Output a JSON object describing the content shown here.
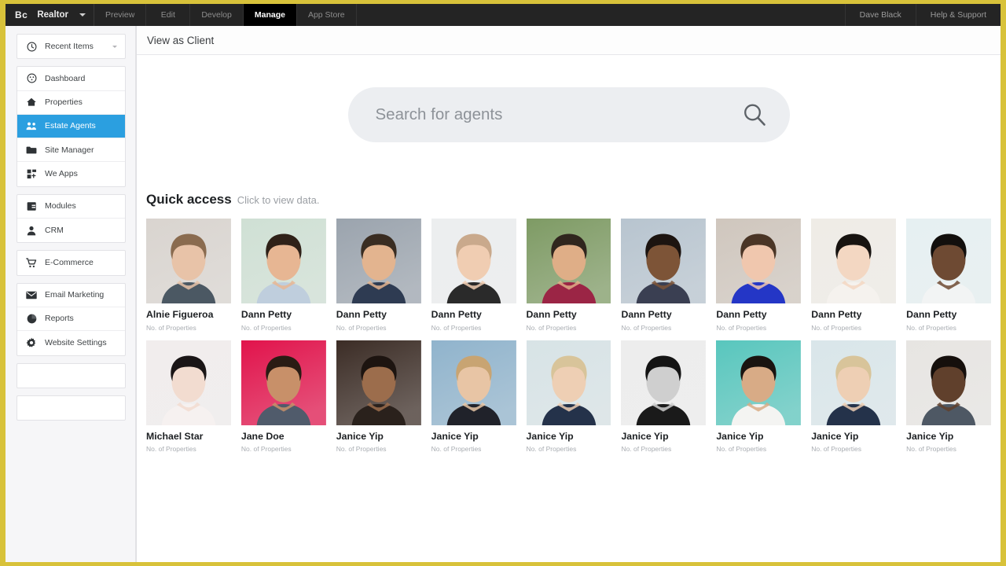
{
  "topbar": {
    "logo_mark": "Bc",
    "site_name": "Realtor",
    "dropdown_icon": "chevron-down-icon",
    "tabs": [
      {
        "label": "Preview",
        "active": false
      },
      {
        "label": "Edit",
        "active": false
      },
      {
        "label": "Develop",
        "active": false
      },
      {
        "label": "Manage",
        "active": true
      },
      {
        "label": "App Store",
        "active": false
      }
    ],
    "right_items": [
      {
        "label": "Dave Black"
      },
      {
        "label": "Help & Support"
      }
    ],
    "bar_color": "#242424",
    "active_tab_color": "#000000"
  },
  "sidebar": {
    "recent": {
      "label": "Recent Items",
      "icon": "clock-icon"
    },
    "items": [
      {
        "label": "Dashboard",
        "icon": "dashboard-icon",
        "active": false
      },
      {
        "label": "Properties",
        "icon": "home-icon",
        "active": false
      },
      {
        "label": "Estate Agents",
        "icon": "people-icon",
        "active": true
      },
      {
        "label": "Site Manager",
        "icon": "folder-icon",
        "active": false
      },
      {
        "label": "We Apps",
        "icon": "apps-icon",
        "active": false
      }
    ],
    "items2": [
      {
        "label": "Modules",
        "icon": "modules-icon",
        "active": false
      },
      {
        "label": "CRM",
        "icon": "person-icon",
        "active": false
      }
    ],
    "items3": [
      {
        "label": "E-Commerce",
        "icon": "cart-icon",
        "active": false
      }
    ],
    "items4": [
      {
        "label": "Email Marketing",
        "icon": "envelope-icon",
        "active": false
      },
      {
        "label": "Reports",
        "icon": "pie-chart-icon",
        "active": false
      },
      {
        "label": "Website Settings",
        "icon": "gear-icon",
        "active": false
      }
    ],
    "empty_rows": 2,
    "active_color": "#2b9fe0"
  },
  "main": {
    "header_title": "View as Client",
    "search": {
      "placeholder": "Search for agents",
      "value": "",
      "icon": "search-icon"
    },
    "quick_access": {
      "title": "Quick access",
      "subtitle": "Click to view data."
    },
    "footer_note": "",
    "cards": [
      {
        "name": "Alnie Figueroa",
        "sub": "No. of Properties",
        "bg": "#d9d4cf",
        "skin": "#e8c3a8",
        "hair": "#8a6b4f",
        "shirt": "#4b5863"
      },
      {
        "name": "Dann Petty",
        "sub": "No. of Properties",
        "bg": "#cfe0d4",
        "skin": "#e7b693",
        "hair": "#2f2118",
        "shirt": "#bfcedd"
      },
      {
        "name": "Dann Petty",
        "sub": "No. of Properties",
        "bg": "#9aa3ad",
        "skin": "#e3b48f",
        "hair": "#3a2d22",
        "shirt": "#2e3b52"
      },
      {
        "name": "Dann Petty",
        "sub": "No. of Properties",
        "bg": "#eceeef",
        "skin": "#f0cdb2",
        "hair": "#c9a98c",
        "shirt": "#2a2a2a"
      },
      {
        "name": "Dann Petty",
        "sub": "No. of Properties",
        "bg": "#7d9a63",
        "skin": "#dfae87",
        "hair": "#30261e",
        "shirt": "#9b2545"
      },
      {
        "name": "Dann Petty",
        "sub": "No. of Properties",
        "bg": "#b7c4cf",
        "skin": "#7d5437",
        "hair": "#1c1410",
        "shirt": "#3a3f52"
      },
      {
        "name": "Dann Petty",
        "sub": "No. of Properties",
        "bg": "#cfc6bd",
        "skin": "#f0c7ae",
        "hair": "#4a3526",
        "shirt": "#2436c6"
      },
      {
        "name": "Dann Petty",
        "sub": "No. of Properties",
        "bg": "#efece6",
        "skin": "#f3d7c2",
        "hair": "#171310",
        "shirt": "#f5f2ee"
      },
      {
        "name": "Dann Petty",
        "sub": "No. of Properties",
        "bg": "#e6f0f2",
        "skin": "#6e4a33",
        "hair": "#120f0d",
        "shirt": "#f2f4f4"
      },
      {
        "name": "Michael Star",
        "sub": "No. of Properties",
        "bg": "#f1eded",
        "skin": "#f2dcd0",
        "hair": "#1a1516",
        "shirt": "#f6f1f0"
      },
      {
        "name": "Jane Doe",
        "sub": "No. of Properties",
        "bg": "#e1114a",
        "skin": "#c89069",
        "hair": "#2a1c14",
        "shirt": "#505b6b"
      },
      {
        "name": "Janice Yip",
        "sub": "No. of Properties",
        "bg": "#3a2b24",
        "skin": "#9c6d4c",
        "hair": "#1d1410",
        "shirt": "#2a211c"
      },
      {
        "name": "Janice Yip",
        "sub": "No. of Properties",
        "bg": "#8fb3cc",
        "skin": "#e8c5a5",
        "hair": "#c8a472",
        "shirt": "#20222a"
      },
      {
        "name": "Janice Yip",
        "sub": "No. of Properties",
        "bg": "#d7e3e6",
        "skin": "#eecfb4",
        "hair": "#d8c49a",
        "shirt": "#24324a"
      },
      {
        "name": "Janice Yip",
        "sub": "No. of Properties",
        "bg": "#ededed",
        "skin": "#cfcfcf",
        "hair": "#141414",
        "shirt": "#1a1a1a"
      },
      {
        "name": "Janice Yip",
        "sub": "No. of Properties",
        "bg": "#57c6bd",
        "skin": "#d8ab86",
        "hair": "#1a1410",
        "shirt": "#f4f4f2"
      },
      {
        "name": "Janice Yip",
        "sub": "No. of Properties",
        "bg": "#d9e6ea",
        "skin": "#eecfb4",
        "hair": "#d8c49a",
        "shirt": "#24324a"
      },
      {
        "name": "Janice Yip",
        "sub": "No. of Properties",
        "bg": "#e7e5e2",
        "skin": "#60402c",
        "hair": "#150f0c",
        "shirt": "#4e5864"
      }
    ]
  }
}
